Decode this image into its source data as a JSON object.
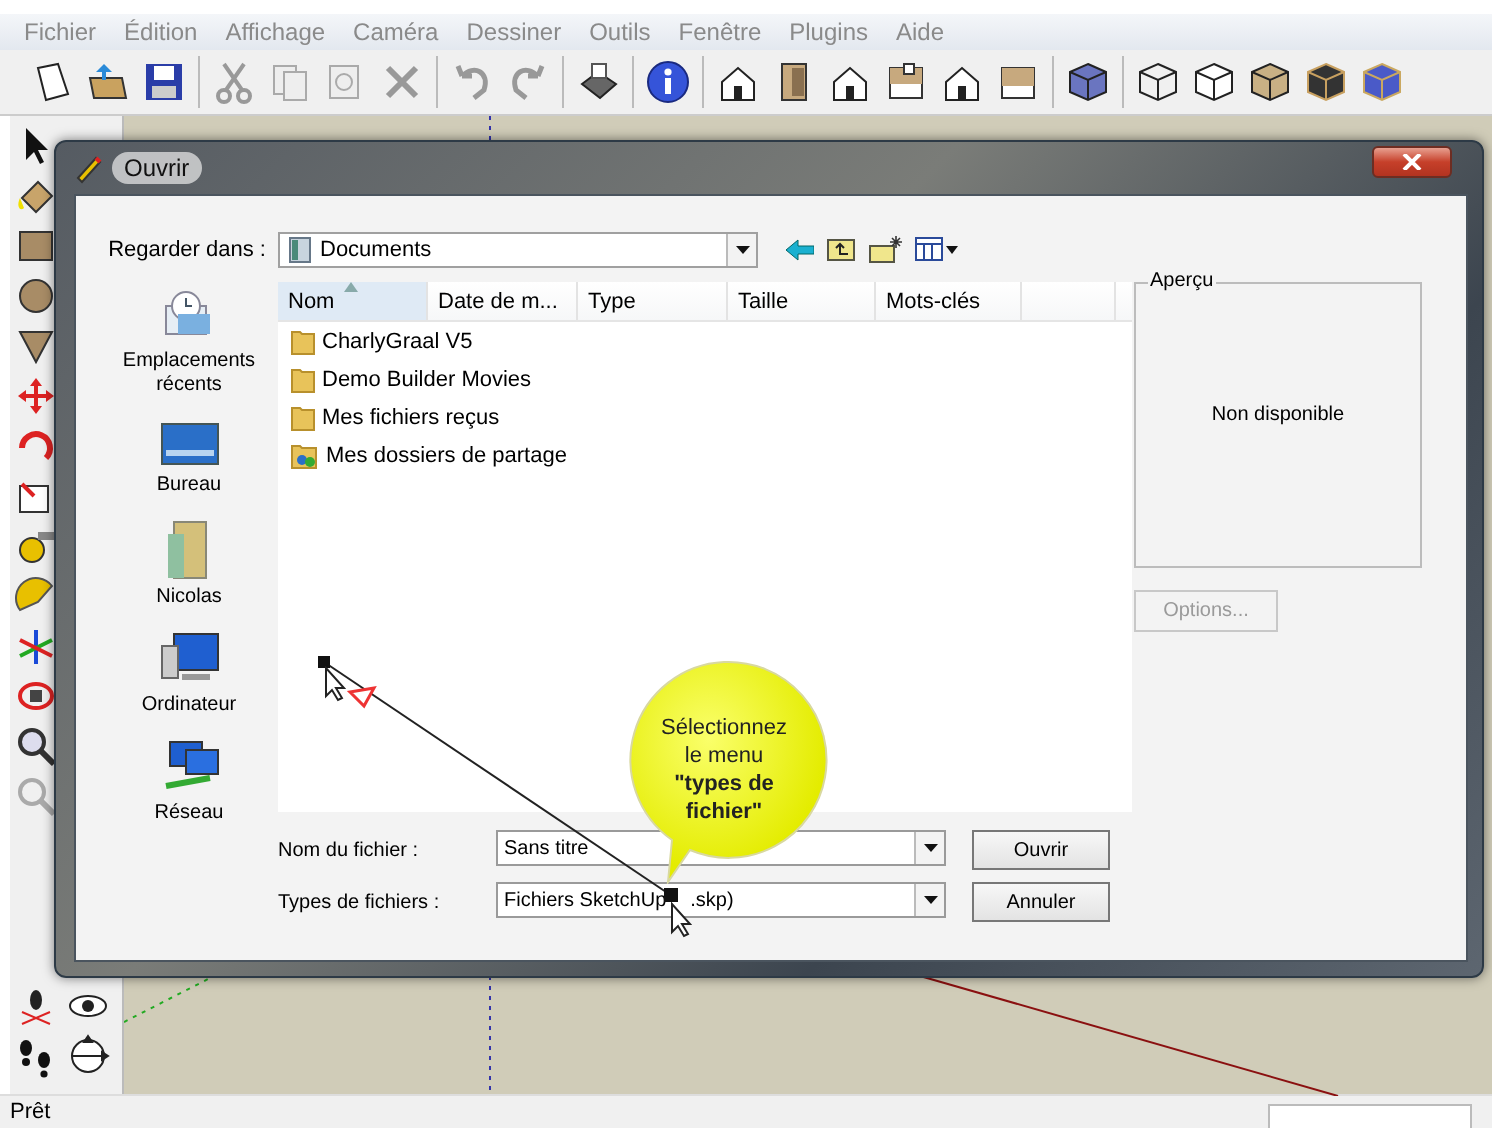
{
  "menu": [
    {
      "label": "Fichier",
      "disabled": true
    },
    {
      "label": "Édition",
      "disabled": true
    },
    {
      "label": "Affichage",
      "disabled": true
    },
    {
      "label": "Caméra",
      "disabled": true
    },
    {
      "label": "Dessiner",
      "disabled": true
    },
    {
      "label": "Outils",
      "disabled": true
    },
    {
      "label": "Fenêtre",
      "disabled": true
    },
    {
      "label": "Plugins",
      "disabled": true
    },
    {
      "label": "Aide",
      "disabled": true
    }
  ],
  "dialog": {
    "title": "Ouvrir",
    "look_in_label": "Regarder dans :",
    "look_in_value": "Documents",
    "places": [
      {
        "label": "Emplacements récents",
        "kind": "recent"
      },
      {
        "label": "Bureau",
        "kind": "desktop"
      },
      {
        "label": "Nicolas",
        "kind": "user"
      },
      {
        "label": "Ordinateur",
        "kind": "computer"
      },
      {
        "label": "Réseau",
        "kind": "network"
      }
    ],
    "columns": [
      {
        "label": "Nom",
        "sorted": true
      },
      {
        "label": "Date de m...",
        "sorted": false
      },
      {
        "label": "Type",
        "sorted": false
      },
      {
        "label": "Taille",
        "sorted": false
      },
      {
        "label": "Mots-clés",
        "sorted": false
      }
    ],
    "files": [
      {
        "name": "CharlyGraal V5",
        "kind": "folder"
      },
      {
        "name": "Demo Builder Movies",
        "kind": "folder"
      },
      {
        "name": "Mes fichiers reçus",
        "kind": "folder"
      },
      {
        "name": "Mes dossiers de partage",
        "kind": "shared"
      }
    ],
    "preview": {
      "label": "Aperçu",
      "message": "Non disponible"
    },
    "options_button": {
      "label": "Options...",
      "disabled": true
    },
    "file_name": {
      "label": "Nom du fichier :",
      "value": "Sans titre"
    },
    "file_type": {
      "label": "Types de fichiers :",
      "value": "Fichiers SketchUp",
      "value_after_cursor": ".skp)"
    },
    "buttons": [
      "Ouvrir",
      "Annuler"
    ]
  },
  "callout": {
    "text": "Sélectionnez le menu **\"types de fichier\"**"
  },
  "status_bar": {
    "text": "Prêt"
  }
}
